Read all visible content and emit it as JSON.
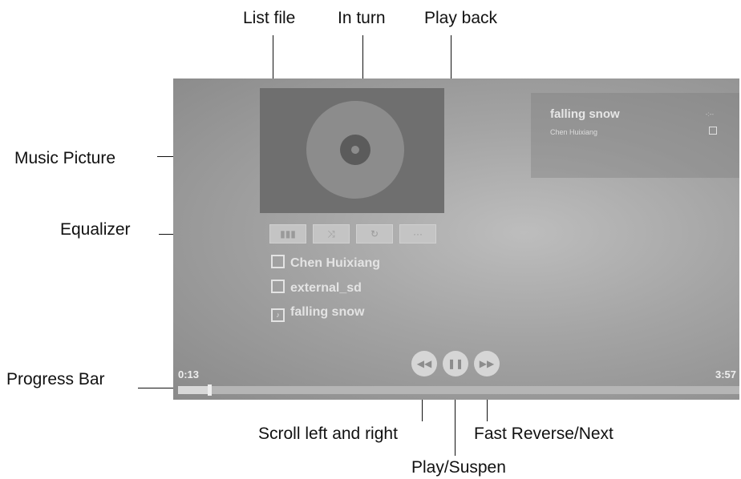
{
  "annotations": {
    "list_file": "List file",
    "in_turn": "In turn",
    "play_back": "Play back",
    "music_picture": "Music Picture",
    "equalizer": "Equalizer",
    "progress_bar": "Progress Bar",
    "scroll": "Scroll left and right",
    "fast": "Fast Reverse/Next",
    "play": "Play/Suspen"
  },
  "playlist": {
    "title": "falling snow",
    "artist": "Chen Huixiang"
  },
  "toolbar": [
    {
      "icon": "equalizer-icon",
      "glyph": "▮▮▮"
    },
    {
      "icon": "shuffle-icon",
      "glyph": "⤨"
    },
    {
      "icon": "repeat-icon",
      "glyph": "↻"
    },
    {
      "icon": "lyrics-icon",
      "glyph": "···"
    }
  ],
  "track_info": {
    "artist": "Chen Huixiang",
    "storage": "external_sd",
    "song": "falling snow"
  },
  "controls": {
    "prev": "◀◀",
    "pause": "❚❚",
    "next": "▶▶"
  },
  "progress": {
    "elapsed": "0:13",
    "total": "3:57",
    "fraction": 0.055
  },
  "colors": {
    "background": "#a4a4a4",
    "accent": "#e3e3e3"
  }
}
